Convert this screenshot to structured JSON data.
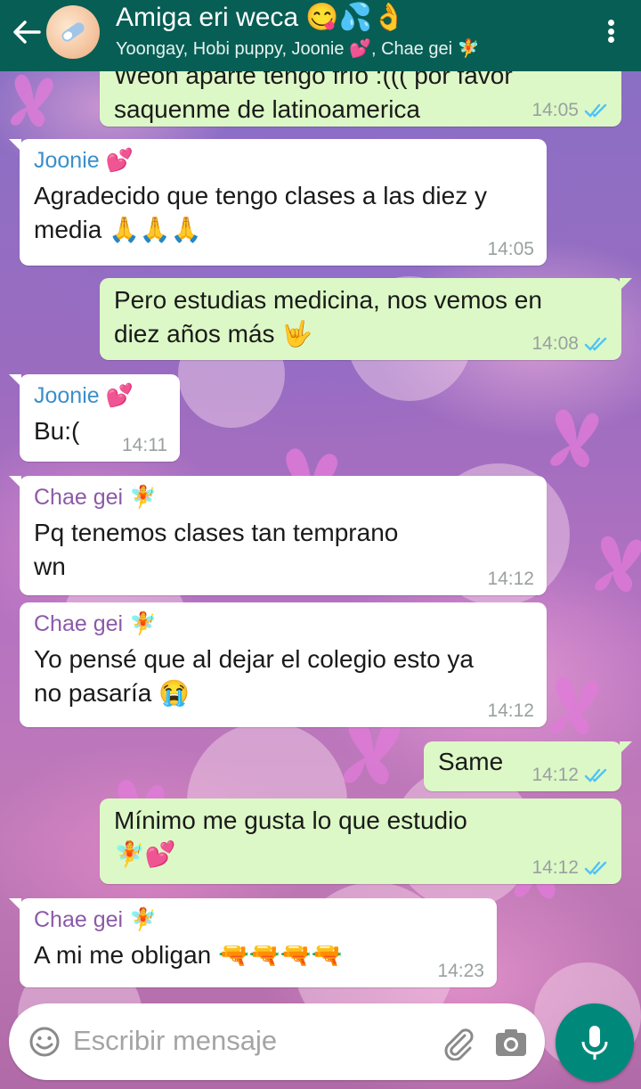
{
  "header": {
    "title": "Amiga eri weca 😋💦👌",
    "subtitle": "Yoongay, Hobi puppy, Joonie 💕, Chae gei 🧚"
  },
  "messages": [
    {
      "direction": "out",
      "text": "Weon aparte tengo frío :((( por favor\nsaquenme de latinoamerica",
      "time": "14:05",
      "read": true
    },
    {
      "direction": "in",
      "sender": "Joonie 💕",
      "text": "Agradecido que tengo clases a las diez y\nmedia 🙏🙏🙏",
      "time": "14:05"
    },
    {
      "direction": "out",
      "text": "Pero estudias medicina, nos vemos en\ndiez años más 🤟",
      "time": "14:08",
      "read": true
    },
    {
      "direction": "in",
      "sender": "Joonie 💕",
      "text": "Bu:(",
      "time": "14:11"
    },
    {
      "direction": "in",
      "sender": "Chae gei 🧚",
      "text": "Pq tenemos clases tan temprano\nwn",
      "time": "14:12"
    },
    {
      "direction": "in",
      "sender": "Chae gei 🧚",
      "text": "Yo pensé que al dejar el colegio esto ya\nno pasaría 😭",
      "time": "14:12"
    },
    {
      "direction": "out",
      "text": "Same",
      "time": "14:12",
      "read": true
    },
    {
      "direction": "out",
      "text": "Mínimo me gusta lo que estudio\n🧚💕",
      "time": "14:12",
      "read": true
    },
    {
      "direction": "in",
      "sender": "Chae gei 🧚",
      "text": "A mi me obligan 🔫🔫🔫🔫",
      "time": "14:23"
    }
  ],
  "composer": {
    "placeholder": "Escribir mensaje"
  },
  "colors": {
    "header": "#075e54",
    "outgoing_bubble": "#dcf8c6",
    "incoming_bubble": "#ffffff",
    "read_ticks": "#4fc3f7",
    "mic_button": "#00897b"
  },
  "icons": [
    "back-arrow-icon",
    "group-avatar",
    "menu-dots-icon",
    "read-ticks-icon",
    "emoji-icon",
    "attach-icon",
    "camera-icon",
    "mic-icon"
  ]
}
